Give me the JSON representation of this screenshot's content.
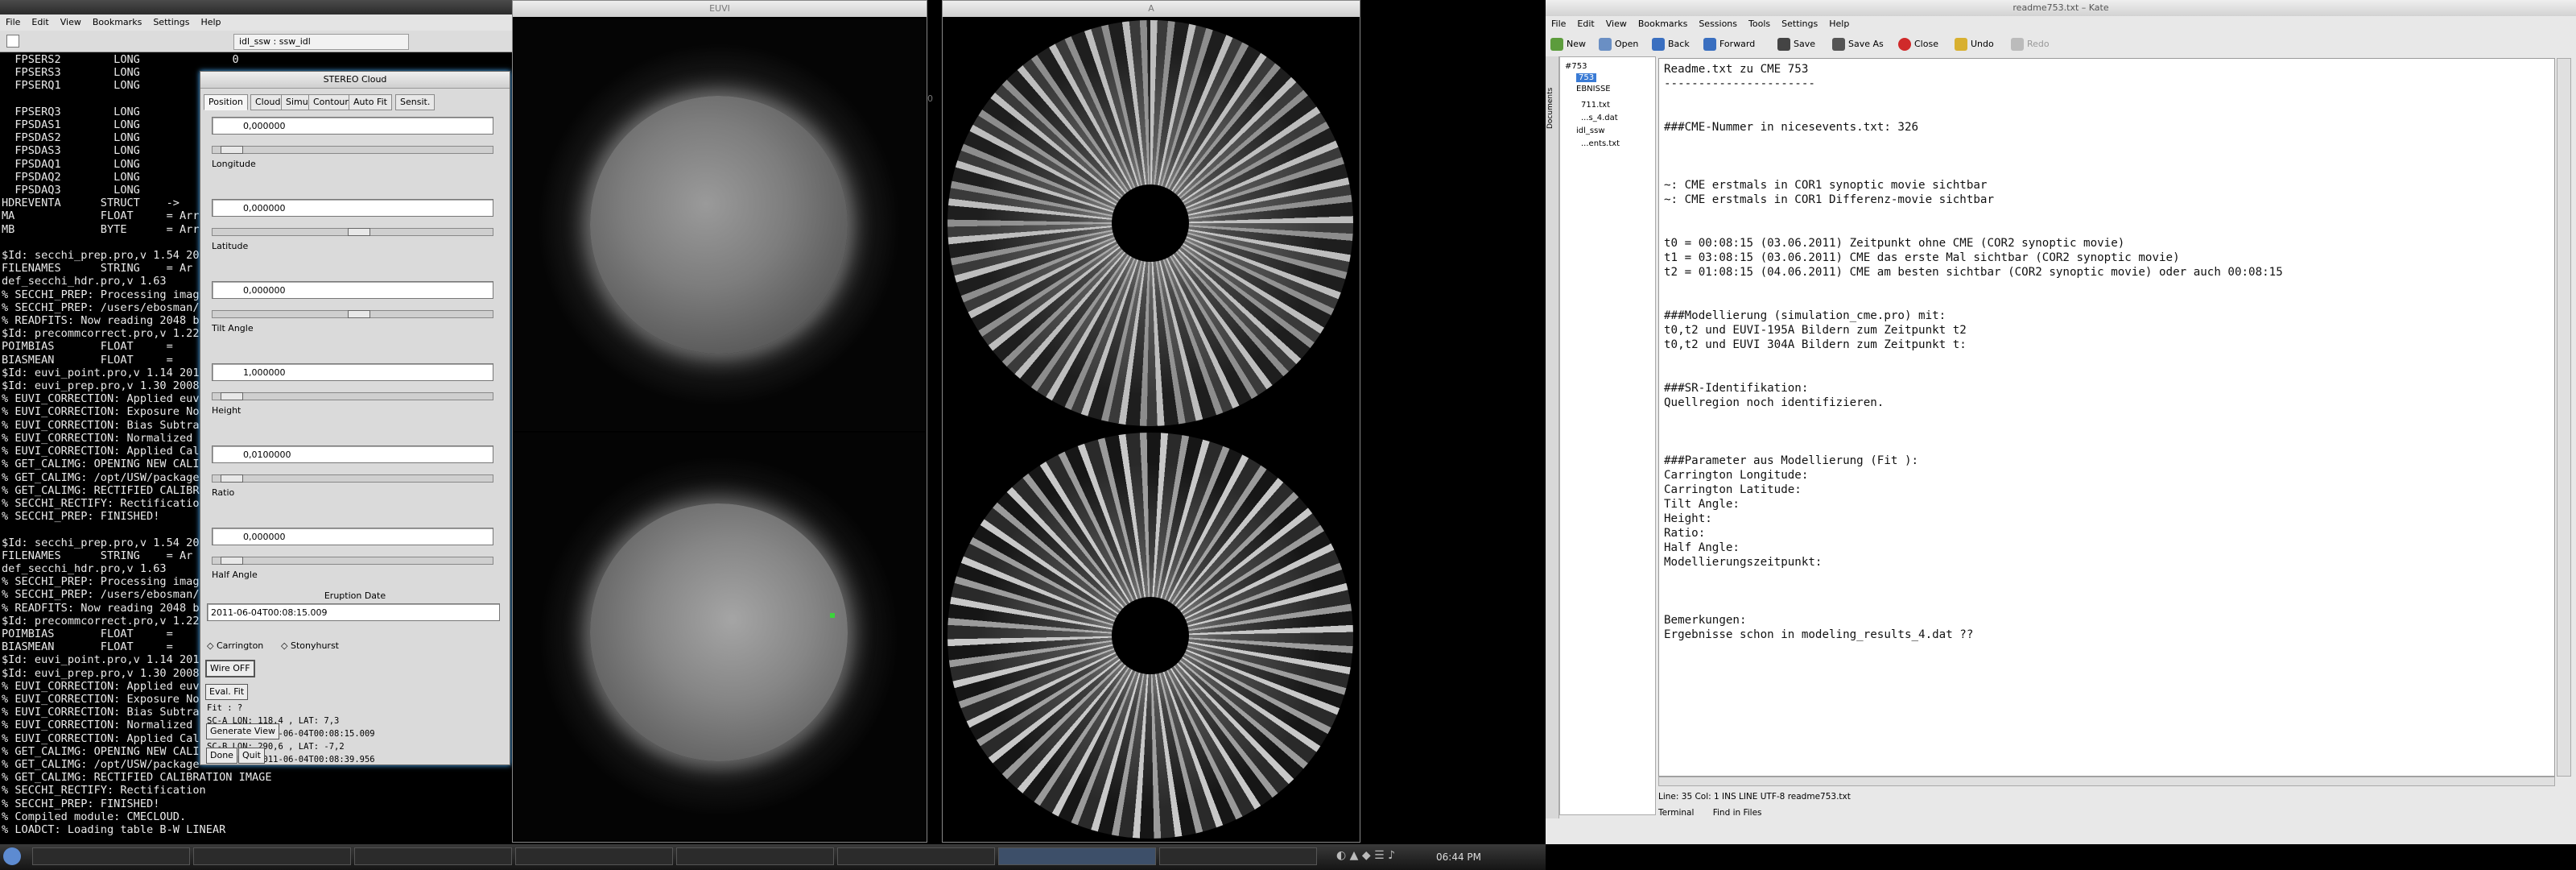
{
  "terminal": {
    "title": "idl_ssw : ssw_idl",
    "menu": [
      "File",
      "Edit",
      "View",
      "Bookmarks",
      "Settings",
      "Help"
    ],
    "lines": [
      "  FPSERS2        LONG              0",
      "  FPSERS3        LONG",
      "  FPSERQ1        LONG",
      "",
      "  FPSERQ3        LONG",
      "  FPSDAS1        LONG",
      "  FPSDAS2        LONG",
      "  FPSDAS3        LONG",
      "  FPSDAQ1        LONG",
      "  FPSDAQ2        LONG",
      "  FPSDAQ3        LONG",
      "HDREVENTA      STRUCT    -> ",
      "MA             FLOAT     = Arr",
      "MB             BYTE      = Arr",
      "",
      "$Id: secchi_prep.pro,v 1.54 20",
      "FILENAMES      STRING    = Ar",
      "def_secchi_hdr.pro,v 1.63",
      "% SECCHI_PREP: Processing image",
      "% SECCHI_PREP: /users/ebosman/",
      "% READFITS: Now reading 2048 b",
      "$Id: precommcorrect.pro,v 1.22",
      "POIMBIAS       FLOAT     =",
      "BIASMEAN       FLOAT     =",
      "$Id: euvi_point.pro,v 1.14 201",
      "$Id: euvi_prep.pro,v 1.30 2008",
      "% EUVI_CORRECTION: Applied euvi",
      "% EUVI_CORRECTION: Exposure Nor",
      "% EUVI_CORRECTION: Bias Subtrac",
      "% EUVI_CORRECTION: Normalized t",
      "% EUVI_CORRECTION: Applied Cali",
      "% GET_CALIMG: OPENING NEW CALIB",
      "% GET_CALIMG: /opt/USW/package",
      "% GET_CALIMG: RECTIFIED CALIBRATION",
      "% SECCHI_RECTIFY: Rectification",
      "% SECCHI_PREP: FINISHED!",
      "",
      "$Id: secchi_prep.pro,v 1.54 20",
      "FILENAMES      STRING    = Ar",
      "def_secchi_hdr.pro,v 1.63",
      "% SECCHI_PREP: Processing image",
      "% SECCHI_PREP: /users/ebosman/",
      "% READFITS: Now reading 2048 b",
      "$Id: precommcorrect.pro,v 1.22",
      "POIMBIAS       FLOAT     =",
      "BIASMEAN       FLOAT     =",
      "$Id: euvi_point.pro,v 1.14 201",
      "$Id: euvi_prep.pro,v 1.30 2008",
      "% EUVI_CORRECTION: Applied euvi",
      "% EUVI_CORRECTION: Exposure Nor",
      "% EUVI_CORRECTION: Bias Subtrac",
      "% EUVI_CORRECTION: Normalized t",
      "% EUVI_CORRECTION: Applied Cali",
      "% GET_CALIMG: OPENING NEW CALIB",
      "% GET_CALIMG: /opt/USW/package",
      "% GET_CALIMG: RECTIFIED CALIBRATION IMAGE",
      "% SECCHI_RECTIFY: Rectification",
      "% SECCHI_PREP: FINISHED!",
      "% Compiled module: CMECLOUD.",
      "% LOADCT: Loading table B-W LINEAR"
    ]
  },
  "stereo_cloud": {
    "title": "STEREO Cloud",
    "tabs": [
      "Position",
      "Cloud",
      "Simu",
      "Contour",
      "Auto Fit",
      "Sensit."
    ],
    "fields": [
      {
        "value": "0,000000",
        "label": "Longitude"
      },
      {
        "value": "0,000000",
        "label": "Latitude"
      },
      {
        "value": "0,000000",
        "label": "Tilt Angle"
      },
      {
        "value": "1,000000",
        "label": "Height"
      },
      {
        "value": "0,0100000",
        "label": "Ratio"
      },
      {
        "value": "0,000000",
        "label": "Half Angle"
      }
    ],
    "eruption_label": "Eruption Date",
    "eruption_value": "2011-06-04T00:08:15.009",
    "radio_carrington": "Carrington",
    "radio_stonyhurst": "Stonyhurst",
    "wire_btn": "Wire OFF",
    "eval_btn": "Eval. Fit",
    "fit_text": "Fit : ?",
    "info_lines": [
      "SC-A LON:  118,4 , LAT:   7,3",
      "Date Obs: 2011-06-04T00:08:15.009",
      "SC-B LON:  290,6 , LAT:  -7,2",
      "Date Obs: 2011-06-04T00:08:39.956"
    ],
    "generate_btn": "Generate View",
    "done_btn": "Done",
    "quit_btn": "Quit"
  },
  "image_windows": {
    "euvi_title": "EUVI",
    "cor_title": "A",
    "side_number": "0"
  },
  "kate": {
    "title": "readme753.txt – Kate",
    "menu": [
      "File",
      "Edit",
      "View",
      "Bookmarks",
      "Sessions",
      "Tools",
      "Settings",
      "Help"
    ],
    "toolbar": [
      "New",
      "Open",
      "Back",
      "Forward",
      "Save",
      "Save As",
      "Close",
      "Undo",
      "Redo"
    ],
    "sidebar_tab": "Documents",
    "tree": [
      "#753",
      "753",
      "EBNISSE",
      "711.txt",
      "...s_4.dat",
      "idl_ssw",
      "...ents.txt"
    ],
    "lines": [
      "Readme.txt zu CME 753",
      "----------------------",
      "",
      "",
      "###CME-Nummer in nicesevents.txt: 326",
      "",
      "",
      "",
      "~: CME erstmals in COR1 synoptic movie sichtbar",
      "~: CME erstmals in COR1 Differenz-movie sichtbar",
      "",
      "",
      "t0 = 00:08:15 (03.06.2011) Zeitpunkt ohne CME (COR2 synoptic movie)",
      "t1 = 03:08:15 (03.06.2011) CME das erste Mal sichtbar (COR2 synoptic movie)",
      "t2 = 01:08:15 (04.06.2011) CME am besten sichtbar (COR2 synoptic movie) oder auch 00:08:15",
      "",
      "",
      "###Modellierung (simulation_cme.pro) mit:",
      "t0,t2 und EUVI-195A Bildern zum Zeitpunkt t2",
      "t0,t2 und EUVI 304A Bildern zum Zeitpunkt t:",
      "",
      "",
      "###SR-Identifikation:",
      "Quellregion noch identifizieren.",
      "",
      "",
      "",
      "###Parameter aus Modellierung (Fit ):",
      "Carrington Longitude:",
      "Carrington Latitude:",
      "Tilt Angle:",
      "Height:",
      "Ratio:",
      "Half Angle:",
      "Modellierungszeitpunkt:",
      "",
      "",
      "",
      "Bemerkungen:",
      "Ergebnisse schon in modeling_results_4.dat ??"
    ],
    "status": "Line: 35 Col: 1        INS   LINE   UTF-8  readme753.txt",
    "bottom_terminal": "Terminal",
    "bottom_find": "Find in Files"
  },
  "taskbar": {
    "tasks": [
      "",
      "",
      "",
      "",
      "",
      "",
      "",
      "",
      ""
    ],
    "time": "06:44 PM"
  }
}
